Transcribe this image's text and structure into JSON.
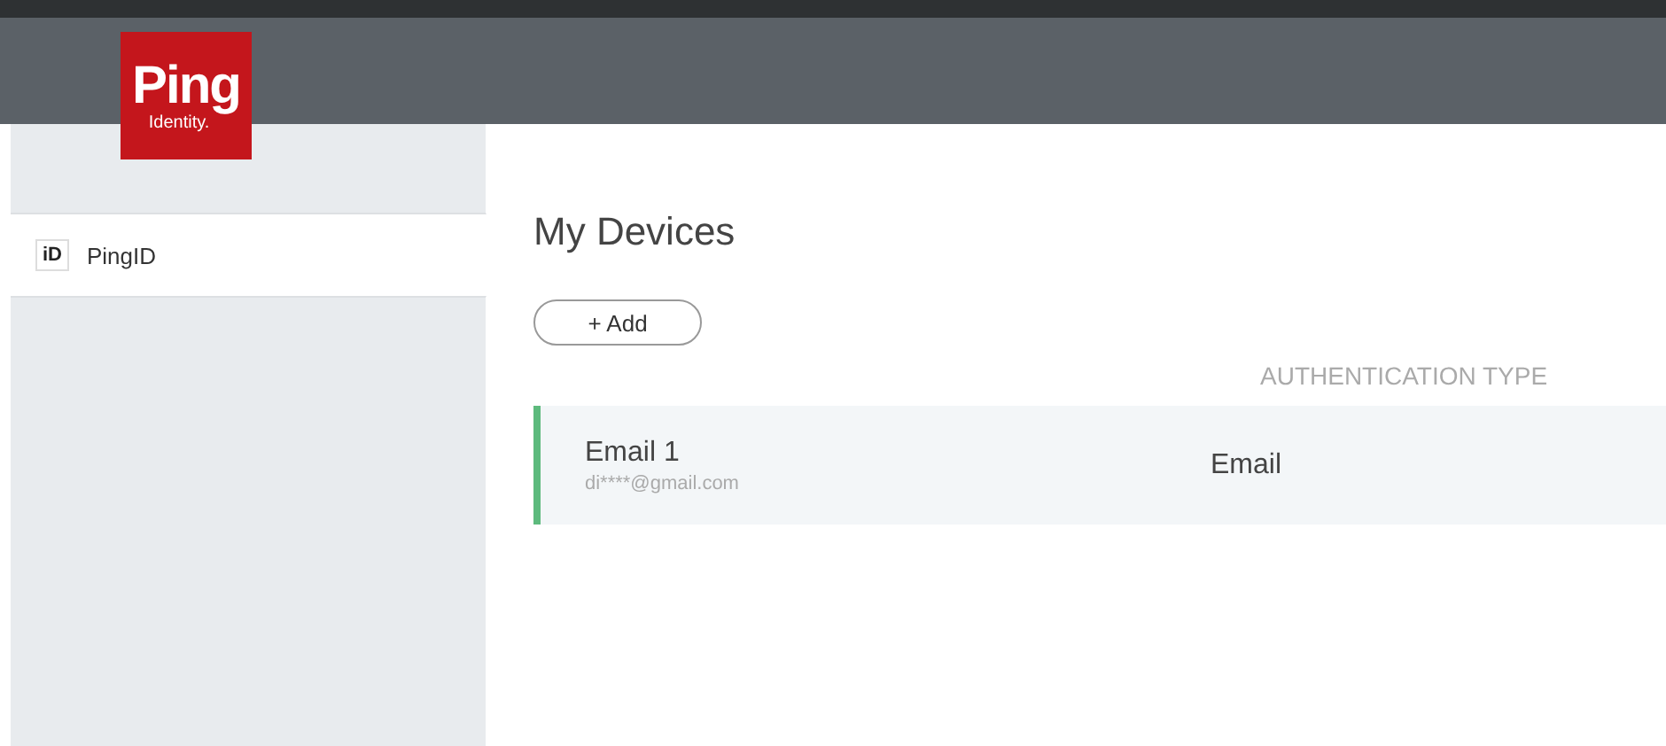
{
  "logo": {
    "wordmark": "Ping",
    "subtitle": "Identity."
  },
  "sidebar": {
    "items": [
      {
        "icon_text": "iD",
        "label": "PingID",
        "selected": true
      }
    ]
  },
  "main": {
    "title": "My Devices",
    "add_button": "+ Add",
    "columns": [
      "AUTHENTICATION TYPE"
    ],
    "devices": [
      {
        "name": "Email 1",
        "detail": "di****@gmail.com",
        "type": "Email",
        "selected": true
      }
    ]
  }
}
